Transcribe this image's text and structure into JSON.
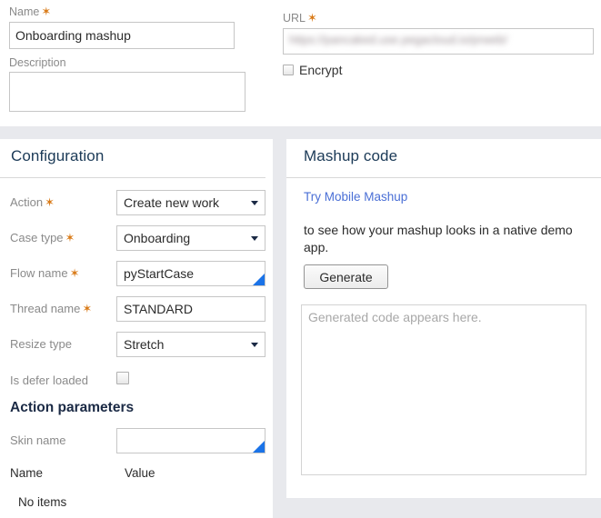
{
  "top_form": {
    "name": {
      "label": "Name",
      "required_marker": "✶",
      "value": "Onboarding mashup",
      "placeholder": ""
    },
    "description": {
      "label": "Description",
      "value": "",
      "placeholder": ""
    },
    "url": {
      "label": "URL",
      "required_marker": "✶",
      "value": "https://pancaked.use.pegacloud.io/prweb/",
      "redacted": true
    },
    "encrypt": {
      "label": "Encrypt",
      "checked": false
    }
  },
  "config_panel": {
    "title": "Configuration",
    "rows": [
      {
        "label": "Action",
        "required_marker": "✶",
        "type": "select",
        "value": "Create new work"
      },
      {
        "label": "Case type",
        "required_marker": "✶",
        "type": "select",
        "value": "Onboarding"
      },
      {
        "label": "Flow name",
        "required_marker": "✶",
        "type": "textfield",
        "value": "pyStartCase"
      },
      {
        "label": "Thread name",
        "required_marker": "✶",
        "type": "textfield",
        "value": "STANDARD"
      },
      {
        "label": "Resize type",
        "required_marker": "",
        "type": "select",
        "value": "Stretch"
      },
      {
        "label": "Is defer loaded",
        "required_marker": "",
        "type": "checkbox",
        "value": ""
      }
    ],
    "action_parameters": {
      "heading": "Action parameters",
      "skin_name": {
        "label": "Skin name",
        "value": "",
        "placeholder": ""
      },
      "table": {
        "columns": [
          "Name",
          "Value"
        ],
        "empty_text": "No items",
        "rows": []
      }
    }
  },
  "mashup_panel": {
    "title": "Mashup code",
    "try_link": "Try Mobile Mashup",
    "demo_text": "to see how your mashup looks in a native demo app.",
    "generate_button": "Generate",
    "code_placeholder": "Generated code appears here.",
    "code_value": ""
  },
  "colors": {
    "required_orange": "#d97b19",
    "panel_title_blue": "#1b3a57",
    "link_blue": "#4a6fd6",
    "corner_blue": "#1a73e8",
    "band_gray": "#e8e9ed",
    "label_gray": "#8a8a8a"
  }
}
